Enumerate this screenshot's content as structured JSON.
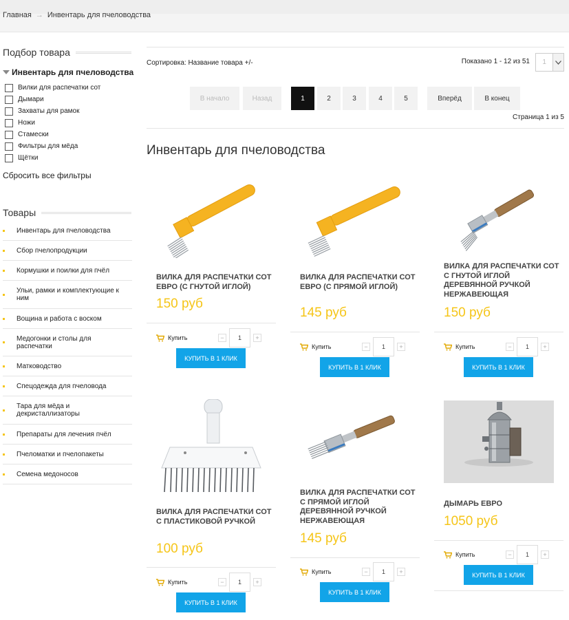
{
  "breadcrumb": {
    "home": "Главная",
    "current": "Инвентарь для пчеловодства"
  },
  "filter": {
    "title": "Подбор товара",
    "group": "Инвентарь для пчеловодства",
    "items": [
      "Вилки для распечатки сот",
      "Дымари",
      "Захваты для рамок",
      "Ножи",
      "Стамески",
      "Фильтры для мёда",
      "Щётки"
    ],
    "reset": "Сбросить все фильтры"
  },
  "goods": {
    "title": "Товары",
    "items": [
      "Инвентарь для пчеловодства",
      "Сбор пчелопродукции",
      "Кормушки и поилки для пчёл",
      "Ульи, рамки и комплектующие к ним",
      "Вощина и работа с воском",
      "Медогонки и столы для распечатки",
      "Матководство",
      "Спецодежда для пчеловода",
      "Тара для мёда и декристаллизаторы",
      "Препараты для лечения пчёл",
      "Пчеломатки и пчелопакеты",
      "Семена медоносов"
    ]
  },
  "toolbar": {
    "sort": "Сортировка: Название товара +/-",
    "shown": "Показано 1 - 12 из 51",
    "per_page": "1"
  },
  "pager": {
    "first": "В начало",
    "prev": "Назад",
    "pages": [
      "1",
      "2",
      "3",
      "4",
      "5"
    ],
    "next": "Вперёд",
    "last": "В конец",
    "summary": "Страница 1 из 5"
  },
  "heading": "Инвентарь для пчеловодства",
  "colors": {
    "accent": "#12a4e8",
    "price": "#f5c518",
    "bullet": "#f5c518"
  },
  "products": [
    {
      "name": "Вилка для распечатки сот евро (с гнутой иглой)",
      "price": "150 руб",
      "image": "yellow-uncapping-fork",
      "qty": "1",
      "buy": "Купить",
      "one_click": "Купить в 1 клик"
    },
    {
      "name": "Вилка для распечатки сот евро (с прямой иглой)",
      "price": "145 руб",
      "image": "yellow-uncapping-fork",
      "qty": "1",
      "buy": "Купить",
      "one_click": "Купить в 1 клик"
    },
    {
      "name": "Вилка для распечатки сот с гнутой иглой деревянной ручкой нержавеющая",
      "price": "150 руб",
      "image": "wooden-handle-fork",
      "qty": "1",
      "buy": "Купить",
      "one_click": "Купить в 1 клик"
    },
    {
      "name": "Вилка для распечатки сот с пластиковой ручкой",
      "price": "100 руб",
      "image": "plastic-fork",
      "qty": "1",
      "buy": "Купить",
      "one_click": "Купить в 1 клик"
    },
    {
      "name": "Вилка для распечатки сот с прямой иглой деревянной ручкой нержавеющая",
      "price": "145 руб",
      "image": "wooden-handle-fork",
      "qty": "1",
      "buy": "Купить",
      "one_click": "Купить в 1 клик"
    },
    {
      "name": "Дымарь евро",
      "price": "1050 руб",
      "image": "bee-smoker",
      "qty": "1",
      "buy": "Купить",
      "one_click": "Купить в 1 клик"
    }
  ]
}
